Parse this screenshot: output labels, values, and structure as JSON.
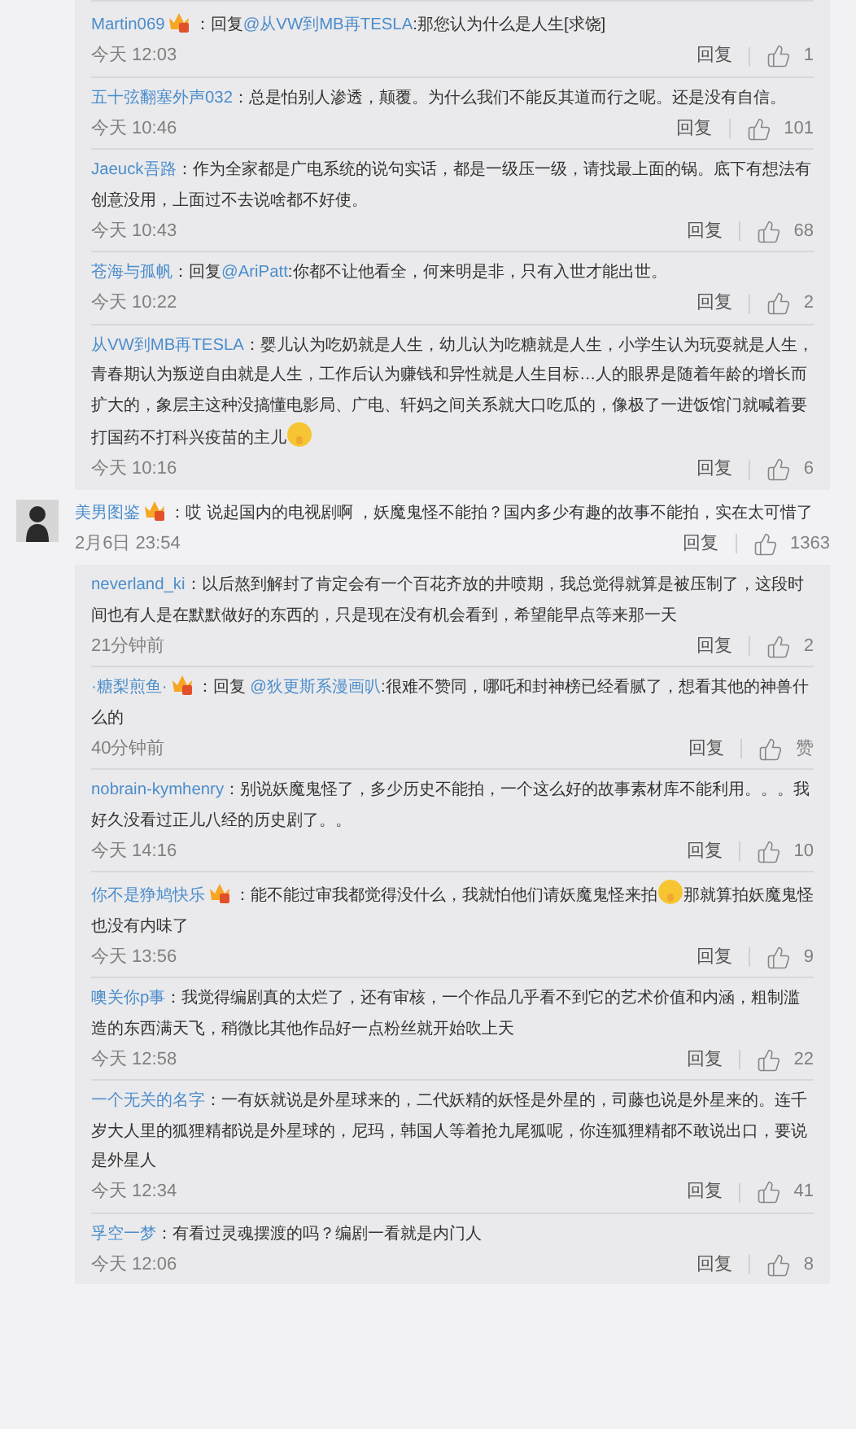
{
  "earlier_replies": [
    {
      "user": "Martin069",
      "badge": true,
      "body": [
        {
          "kind": "text",
          "text": "：回复"
        },
        {
          "kind": "mention",
          "text": "@从VW到MB再TESLA"
        },
        {
          "kind": "text",
          "text": ":那您认为什么是人生[求饶]"
        }
      ],
      "time": "今天 12:03",
      "reply": "回复",
      "likes": "1"
    },
    {
      "user": "五十弦翻塞外声032",
      "badge": false,
      "body": [
        {
          "kind": "text",
          "text": "：总是怕别人渗透，颠覆。为什么我们不能反其道而行之呢。还是没有自信。"
        }
      ],
      "time": "今天 10:46",
      "reply": "回复",
      "likes": "101"
    },
    {
      "user": "Jaeuck吾路",
      "badge": false,
      "body": [
        {
          "kind": "text",
          "text": "：作为全家都是广电系统的说句实话，都是一级压一级，请找最上面的锅。底下有想法有创意没用，上面过不去说啥都不好使。"
        }
      ],
      "time": "今天 10:43",
      "reply": "回复",
      "likes": "68"
    },
    {
      "user": "苍海与孤帆",
      "badge": false,
      "body": [
        {
          "kind": "text",
          "text": "：回复"
        },
        {
          "kind": "mention",
          "text": "@AriPatt"
        },
        {
          "kind": "text",
          "text": ":你都不让他看全，何来明是非，只有入世才能出世。"
        }
      ],
      "time": "今天 10:22",
      "reply": "回复",
      "likes": "2"
    },
    {
      "user": "从VW到MB再TESLA",
      "badge": false,
      "body": [
        {
          "kind": "text",
          "text": "：婴儿认为吃奶就是人生，幼儿认为吃糖就是人生，小学生认为玩耍就是人生，青春期认为叛逆自由就是人生，工作后认为赚钱和异性就是人生目标…人的眼界是随着年龄的增长而扩大的，象层主这种没搞懂电影局、广电、轩妈之间关系就大口吃瓜的，像极了一进饭馆门就喊着要打国药不打科兴疫苗的主儿"
        },
        {
          "kind": "emoji"
        }
      ],
      "time": "今天 10:16",
      "reply": "回复",
      "likes": "6"
    }
  ],
  "comment": {
    "user": "美男图鉴",
    "badge": true,
    "body": [
      {
        "kind": "text",
        "text": "：哎 说起国内的电视剧啊  ，妖魔鬼怪不能拍？国内多少有趣的故事不能拍，实在太可惜了"
      }
    ],
    "time": "2月6日 23:54",
    "reply": "回复",
    "likes": "1363"
  },
  "replies": [
    {
      "user": "neverland_ki",
      "badge": false,
      "body": [
        {
          "kind": "text",
          "text": "：以后熬到解封了肯定会有一个百花齐放的井喷期，我总觉得就算是被压制了，这段时间也有人是在默默做好的东西的，只是现在没有机会看到，希望能早点等来那一天"
        }
      ],
      "time": "21分钟前",
      "reply": "回复",
      "likes": "2"
    },
    {
      "user": "·糖梨煎鱼·",
      "badge": true,
      "body": [
        {
          "kind": "text",
          "text": "：回复 "
        },
        {
          "kind": "mention",
          "text": "@狄更斯系漫画叭"
        },
        {
          "kind": "text",
          "text": ":很难不赞同，哪吒和封神榜已经看腻了，想看其他的神兽什么的"
        }
      ],
      "time": "40分钟前",
      "reply": "回复",
      "likes": "赞"
    },
    {
      "user": "nobrain-kymhenry",
      "badge": false,
      "body": [
        {
          "kind": "text",
          "text": "：别说妖魔鬼怪了，多少历史不能拍，一个这么好的故事素材库不能利用。。。我好久没看过正儿八经的历史剧了。。"
        }
      ],
      "time": "今天 14:16",
      "reply": "回复",
      "likes": "10"
    },
    {
      "user": "你不是狰鸠快乐",
      "badge": true,
      "body": [
        {
          "kind": "text",
          "text": "：能不能过审我都觉得没什么，我就怕他们请妖魔鬼怪来拍"
        },
        {
          "kind": "emoji"
        },
        {
          "kind": "text",
          "text": "那就算拍妖魔鬼怪也没有内味了"
        }
      ],
      "time": "今天 13:56",
      "reply": "回复",
      "likes": "9"
    },
    {
      "user": "噢关你p事",
      "badge": false,
      "body": [
        {
          "kind": "text",
          "text": "：我觉得编剧真的太烂了，还有审核，一个作品几乎看不到它的艺术价值和内涵，粗制滥造的东西满天飞，稍微比其他作品好一点粉丝就开始吹上天"
        }
      ],
      "time": "今天 12:58",
      "reply": "回复",
      "likes": "22"
    },
    {
      "user": "一个无关的名字",
      "badge": false,
      "body": [
        {
          "kind": "text",
          "text": "：一有妖就说是外星球来的，二代妖精的妖怪是外星的，司藤也说是外星来的。连千岁大人里的狐狸精都说是外星球的，尼玛，韩国人等着抢九尾狐呢，你连狐狸精都不敢说出口，要说是外星人"
        }
      ],
      "time": "今天 12:34",
      "reply": "回复",
      "likes": "41"
    },
    {
      "user": "孚空一梦",
      "badge": false,
      "body": [
        {
          "kind": "text",
          "text": "：有看过灵魂摆渡的吗？编剧一看就是内门人"
        }
      ],
      "time": "今天 12:06",
      "reply": "回复",
      "likes": "8"
    }
  ]
}
